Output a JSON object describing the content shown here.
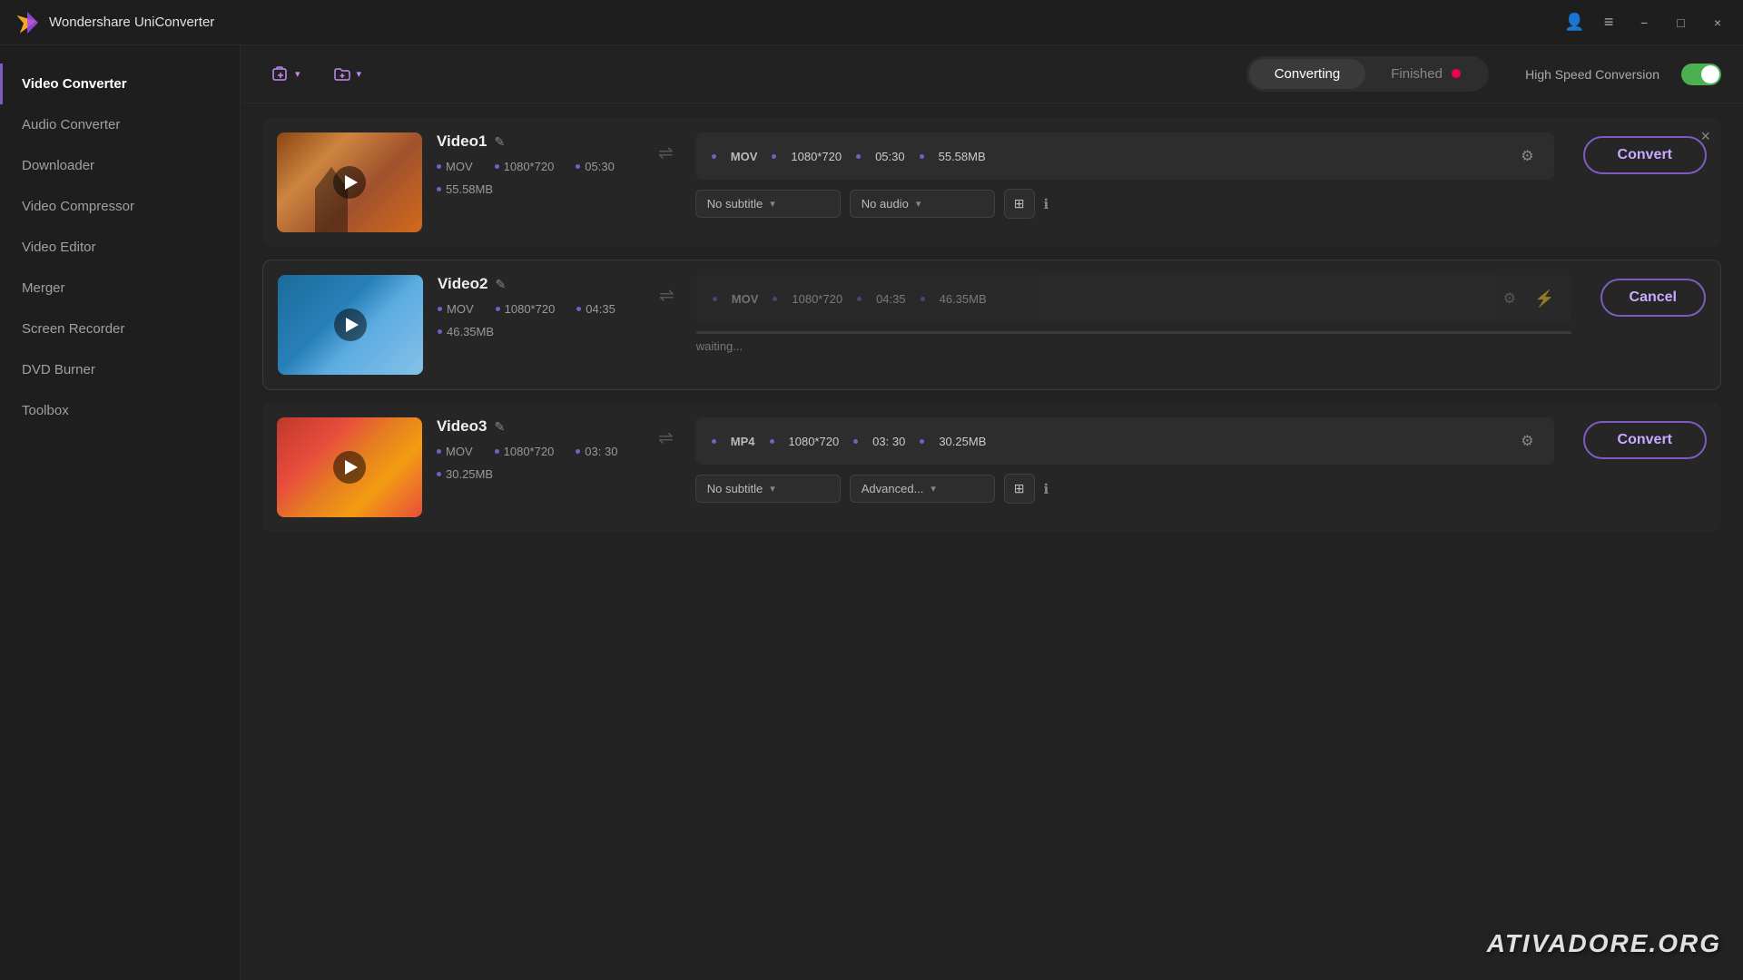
{
  "app": {
    "title": "Wondershare UniConverter",
    "logo_color": "#f5a623"
  },
  "titlebar": {
    "avatar_icon": "👤",
    "menu_icon": "≡",
    "minimize_label": "−",
    "maximize_label": "□",
    "close_label": "×"
  },
  "sidebar": {
    "active": "Video Converter",
    "items": [
      {
        "label": "Video Converter"
      },
      {
        "label": "Audio Converter"
      },
      {
        "label": "Downloader"
      },
      {
        "label": "Video Compressor"
      },
      {
        "label": "Video Editor"
      },
      {
        "label": "Merger"
      },
      {
        "label": "Screen Recorder"
      },
      {
        "label": "DVD Burner"
      },
      {
        "label": "Toolbox"
      }
    ]
  },
  "toolbar": {
    "add_files_label": "▾",
    "add_folder_label": "▾",
    "tab_converting": "Converting",
    "tab_finished": "Finished",
    "hsc_label": "High Speed Conversion",
    "hsc_enabled": true
  },
  "videos": [
    {
      "id": "video1",
      "title": "Video1",
      "format": "MOV",
      "resolution": "1080*720",
      "duration": "05:30",
      "size": "55.58MB",
      "output": {
        "format": "MOV",
        "resolution": "1080*720",
        "duration": "05:30",
        "size": "55.58MB"
      },
      "subtitle": "No subtitle",
      "audio": "No audio",
      "status": "ready",
      "convert_label": "Convert"
    },
    {
      "id": "video2",
      "title": "Video2",
      "format": "MOV",
      "resolution": "1080*720",
      "duration": "04:35",
      "size": "46.35MB",
      "output": {
        "format": "MOV",
        "resolution": "1080*720",
        "duration": "04:35",
        "size": "46.35MB"
      },
      "status": "converting",
      "waiting_text": "waiting...",
      "cancel_label": "Cancel"
    },
    {
      "id": "video3",
      "title": "Video3",
      "format": "MOV",
      "resolution": "1080*720",
      "duration": "03: 30",
      "size": "30.25MB",
      "output": {
        "format": "MP4",
        "resolution": "1080*720",
        "duration": "03: 30",
        "size": "30.25MB"
      },
      "subtitle": "No subtitle",
      "audio": "Advanced...",
      "status": "ready",
      "convert_label": "Convert"
    }
  ],
  "watermark": {
    "text": "ATIVADORE.ORG"
  }
}
